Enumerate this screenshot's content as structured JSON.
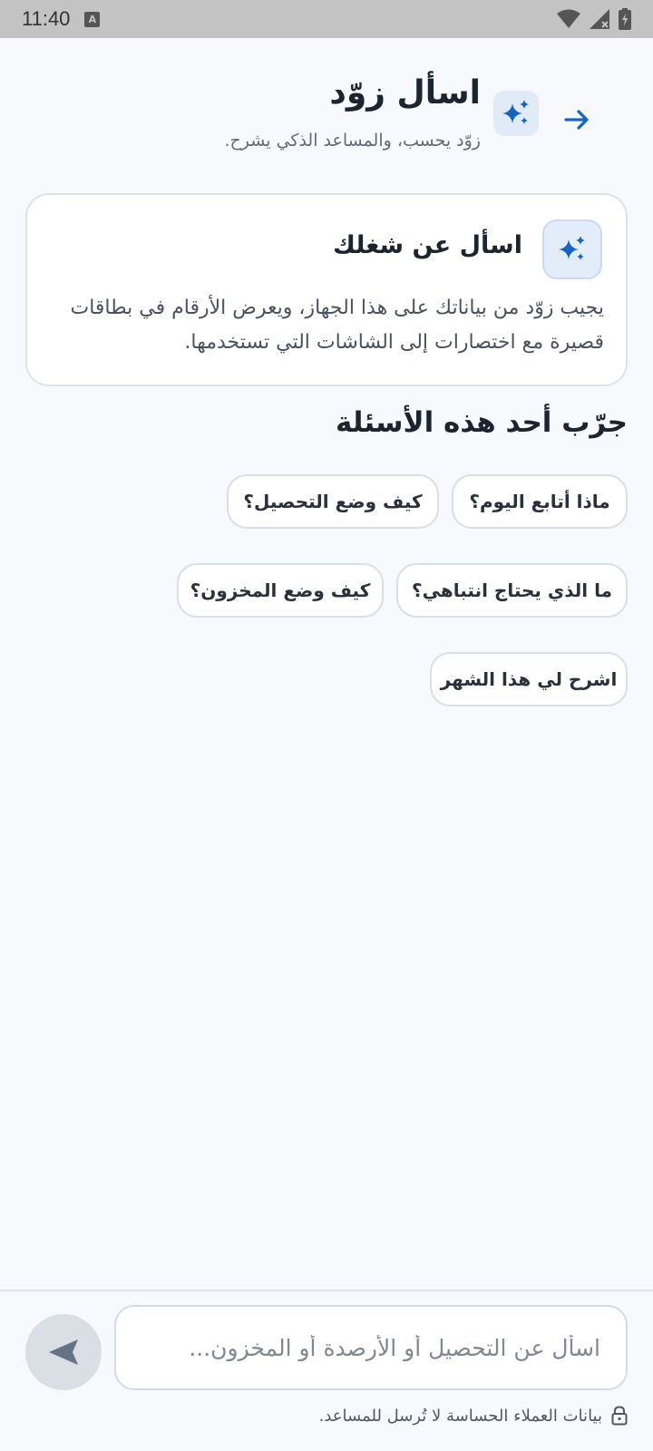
{
  "status_bar": {
    "time": "11:40",
    "notification_icon": "a-icon"
  },
  "header": {
    "title": "اسأل زوّد",
    "subtitle": "زوّد يحسب، والمساعد الذكي يشرح.",
    "back_icon": "arrow-right-icon",
    "badge_icon": "sparkles-icon"
  },
  "info_card": {
    "title": "اسأل عن شغلك",
    "body": "يجيب زوّد من بياناتك على هذا الجهاز، ويعرض الأرقام في بطاقات قصيرة مع اختصارات إلى الشاشات التي تستخدمها.",
    "icon": "sparkles-icon"
  },
  "suggestions": {
    "title": "جرّب أحد هذه الأسئلة",
    "items": [
      "ماذا أتابع اليوم؟",
      "كيف وضع التحصيل؟",
      "ما الذي يحتاج انتباهي؟",
      "كيف وضع المخزون؟",
      "اشرح لي هذا الشهر"
    ]
  },
  "composer": {
    "placeholder": "اسأل عن التحصيل أو الأرصدة أو المخزون...",
    "send_icon": "send-icon"
  },
  "footer": {
    "note": "بيانات العملاء الحساسة لا تُرسل للمساعد.",
    "icon": "lock-icon"
  },
  "colors": {
    "accent": "#1565c0",
    "background": "#f7f9fd"
  }
}
